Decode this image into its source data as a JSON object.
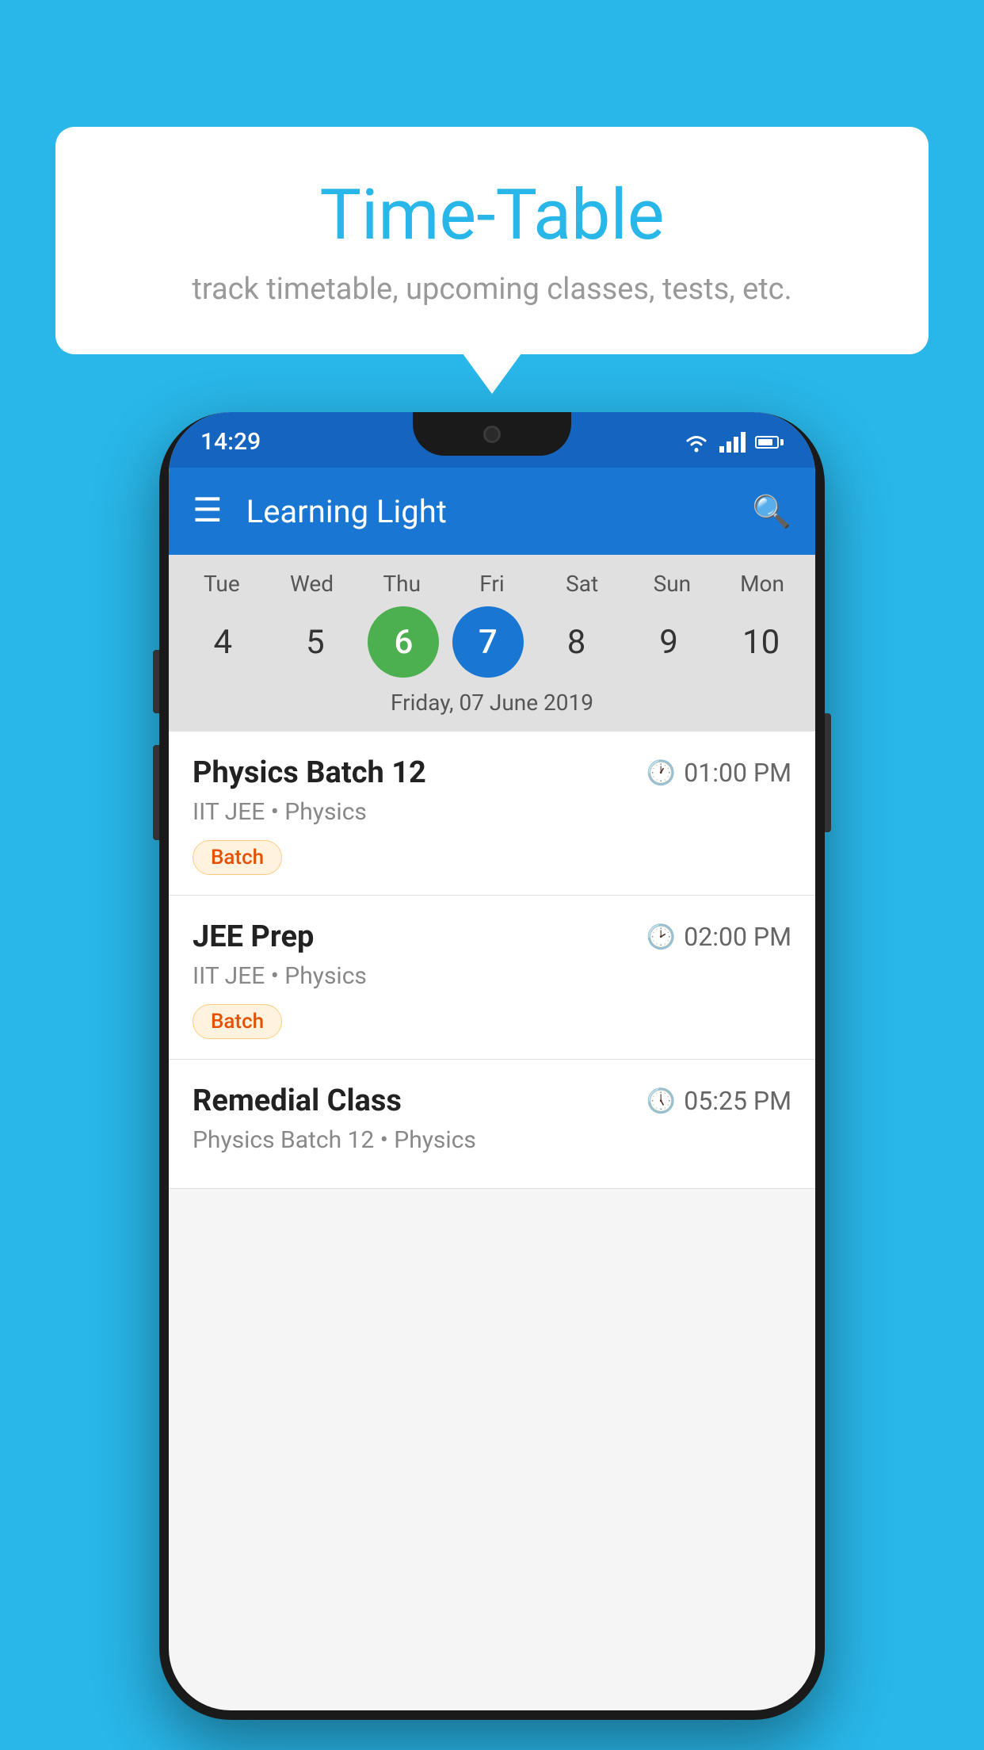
{
  "background_color": "#29B6E8",
  "bubble": {
    "title": "Time-Table",
    "subtitle": "track timetable, upcoming classes, tests, etc."
  },
  "phone": {
    "status_bar": {
      "time": "14:29"
    },
    "app_bar": {
      "title": "Learning Light"
    },
    "calendar": {
      "days": [
        "Tue",
        "Wed",
        "Thu",
        "Fri",
        "Sat",
        "Sun",
        "Mon"
      ],
      "dates": [
        "4",
        "5",
        "6",
        "7",
        "8",
        "9",
        "10"
      ],
      "today_index": 2,
      "selected_index": 3,
      "date_label": "Friday, 07 June 2019"
    },
    "schedule": [
      {
        "title": "Physics Batch 12",
        "time": "01:00 PM",
        "subtitle": "IIT JEE • Physics",
        "badge": "Batch"
      },
      {
        "title": "JEE Prep",
        "time": "02:00 PM",
        "subtitle": "IIT JEE • Physics",
        "badge": "Batch"
      },
      {
        "title": "Remedial Class",
        "time": "05:25 PM",
        "subtitle": "Physics Batch 12 • Physics",
        "badge": null
      }
    ]
  }
}
